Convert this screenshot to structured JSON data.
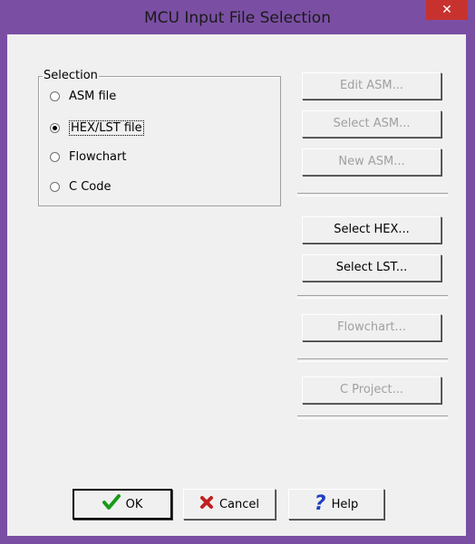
{
  "window": {
    "title": "MCU Input File Selection",
    "close_glyph": "✕"
  },
  "selection": {
    "group_label": "Selection",
    "options": [
      {
        "label": "ASM file",
        "checked": false
      },
      {
        "label": "HEX/LST file",
        "checked": true
      },
      {
        "label": "Flowchart",
        "checked": false
      },
      {
        "label": "C Code",
        "checked": false
      }
    ]
  },
  "buttons": {
    "edit_asm": "Edit ASM...",
    "select_asm": "Select ASM...",
    "new_asm": "New ASM...",
    "select_hex": "Select HEX...",
    "select_lst": "Select LST...",
    "flowchart": "Flowchart...",
    "c_project": "C Project..."
  },
  "footer": {
    "ok": "OK",
    "cancel": "Cancel",
    "help": "Help"
  },
  "icons": {
    "ok": "check-icon",
    "cancel": "x-icon",
    "help": "question-icon"
  },
  "colors": {
    "titlebar": "#7a4fa3",
    "close_button": "#c7322e",
    "dialog_bg": "#f0f0f0",
    "ok_icon": "#1a9a1a",
    "cancel_icon": "#c02020",
    "help_icon": "#1f3fbf"
  }
}
